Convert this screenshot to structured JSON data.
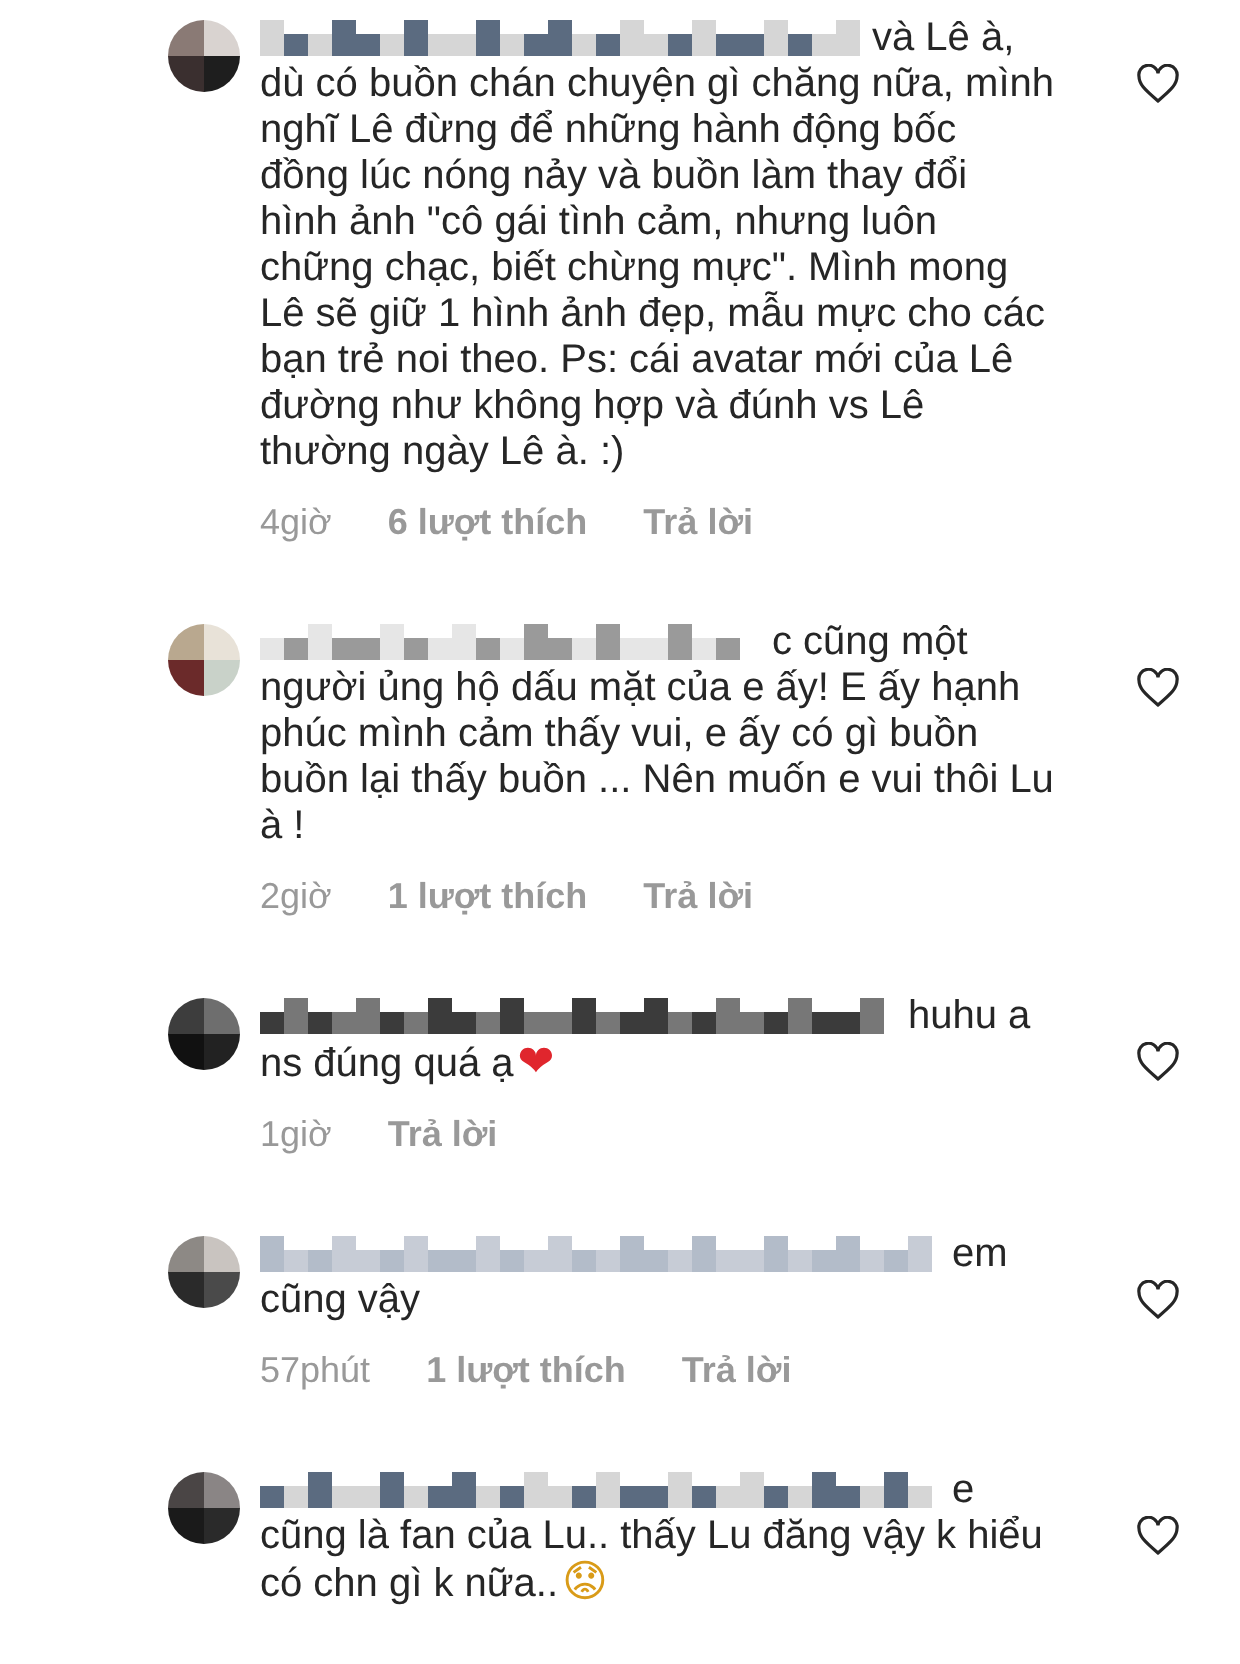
{
  "comments": [
    {
      "lead": "và Lê à,",
      "text": "dù có buồn chán chuyện gì chăng nữa, mình nghĩ Lê đừng để những hành động bốc đồng lúc nóng nảy và buồn làm thay đổi hình ảnh \"cô gái tình cảm, nhưng luôn chững chạc, biết chừng mực\". Mình mong Lê sẽ giữ 1 hình ảnh đẹp, mẫu mực cho các bạn trẻ noi theo. Ps: cái avatar mới của Lê đường như không hợp và đúnh vs Lê thường ngày Lê à. :)",
      "time": "4giờ",
      "likes": "6 lượt thích",
      "reply": "Trả lời"
    },
    {
      "lead": "c cũng một",
      "text": "người ủng hộ dấu mặt của e ấy! E ấy hạnh phúc mình cảm thấy vui, e ấy có gì buồn buồn lại thấy buồn ... Nên muốn e vui thôi Lu à !",
      "time": "2giờ",
      "likes": "1 lượt thích",
      "reply": "Trả lời"
    },
    {
      "lead": "huhu a",
      "text": "ns đúng quá ạ",
      "emoji": "❤",
      "color": "#e0262d",
      "time": "1giờ",
      "reply": "Trả lời"
    },
    {
      "lead": "em",
      "text": "cũng vậy",
      "time": "57phút",
      "likes": "1 lượt thích",
      "reply": "Trả lời"
    },
    {
      "lead": "e",
      "text": "cũng là fan của Lu.. thấy Lu đăng vậy k hiểu có chn gì k nữa..",
      "emoji": "😟",
      "color": "#d99b18"
    }
  ]
}
